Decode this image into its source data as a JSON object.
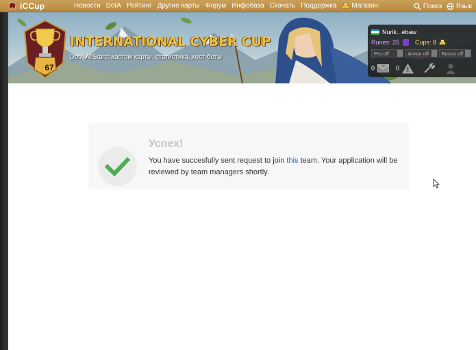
{
  "brand": {
    "name": "iCCup"
  },
  "nav": {
    "items": [
      "Новости",
      "DotA",
      "Рейтинг",
      "Другие карты",
      "Форум",
      "Инфобаза",
      "Скачать",
      "Поддержка"
    ],
    "shop": "Магазин",
    "search": "Поиск",
    "language": "Язык"
  },
  "banner": {
    "title": "INTERNATIONAL CYBER CUP",
    "subtitle": "DotA AllStars: кастом карты, статистика, хост-боты",
    "level": "67"
  },
  "user": {
    "name": "Nurik...ebaw",
    "runes_label": "Runes: 25",
    "cups_label": "Cups: 8",
    "toggles": [
      "Pro off",
      "Armor off",
      "Bonus off"
    ],
    "messages": "0",
    "warnings": "0"
  },
  "alert": {
    "title": "Успех!",
    "text_before": "You have succesfully sent request to join ",
    "link": "this",
    "text_after": " team. Your application will be reviewed by team managers shortly."
  },
  "colors": {
    "nav_gold": "#b8893f",
    "success_green": "#4caf50",
    "link_blue": "#1f5fa8"
  }
}
